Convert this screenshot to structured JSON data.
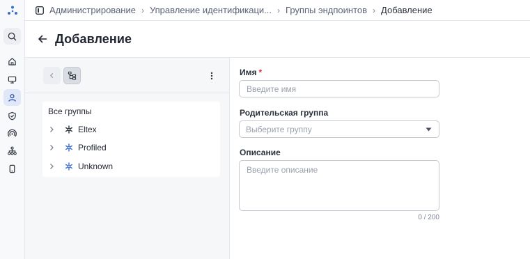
{
  "breadcrumbs": [
    "Администрирование",
    "Управление идентификаци...",
    "Группы эндпоинтов",
    "Добавление"
  ],
  "page": {
    "title": "Добавление"
  },
  "tree": {
    "root_label": "Все группы",
    "nodes": [
      {
        "label": "Eltex",
        "icon": "network-icon",
        "color": "#2b313c"
      },
      {
        "label": "Profiled",
        "icon": "network-icon",
        "color": "#3a6fd8"
      },
      {
        "label": "Unknown",
        "icon": "network-icon",
        "color": "#3a6fd8"
      }
    ]
  },
  "form": {
    "name": {
      "label": "Имя",
      "required_mark": "*",
      "placeholder": "Введите имя",
      "value": ""
    },
    "parent": {
      "label": "Родительская группа",
      "placeholder": "Выберите группу"
    },
    "description": {
      "label": "Описание",
      "placeholder": "Введите описание",
      "value": "",
      "counter": "0 / 200"
    }
  },
  "colors": {
    "accent": "#3a6fd8",
    "active_nav_bg": "#dfe7f8",
    "required": "#d8363f"
  },
  "nav_icons": [
    "logo-icon",
    "search-icon",
    "home-icon",
    "monitor-icon",
    "user-icon",
    "shield-icon",
    "broadcast-icon",
    "hierarchy-icon",
    "phone-icon"
  ]
}
